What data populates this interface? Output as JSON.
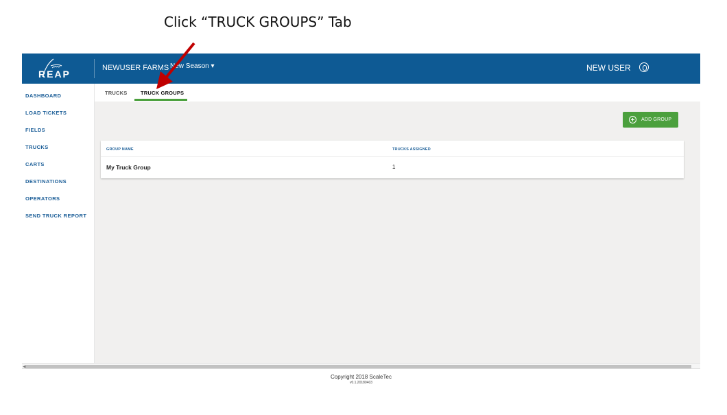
{
  "instruction": "Click “TRUCK GROUPS” Tab",
  "header": {
    "logo_text": "REAP",
    "farm_name": "NEWUSER FARMS",
    "season": "New Season ▾",
    "user_name": "NEW USER",
    "brand_color": "#0e5a94"
  },
  "sidebar": {
    "items": [
      {
        "label": "DASHBOARD"
      },
      {
        "label": "LOAD TICKETS"
      },
      {
        "label": "FIELDS"
      },
      {
        "label": "TRUCKS"
      },
      {
        "label": "CARTS"
      },
      {
        "label": "DESTINATIONS"
      },
      {
        "label": "OPERATORS"
      },
      {
        "label": "SEND TRUCK REPORT"
      }
    ]
  },
  "tabs": [
    {
      "label": "TRUCKS",
      "active": false
    },
    {
      "label": "TRUCK GROUPS",
      "active": true
    }
  ],
  "toolbar": {
    "add_group_label": "ADD GROUP",
    "accent_color": "#4ba03d"
  },
  "table": {
    "columns": [
      "GROUP NAME",
      "TRUCKS ASSIGNED"
    ],
    "rows": [
      {
        "group_name": "My Truck Group",
        "trucks_assigned": "1"
      }
    ]
  },
  "footer": {
    "copyright": "Copyright 2018 ScaleTec",
    "version": "v0.1.20180403"
  },
  "annotation": {
    "arrow_color": "#c00000",
    "icon": "arrow-pointer-icon"
  }
}
